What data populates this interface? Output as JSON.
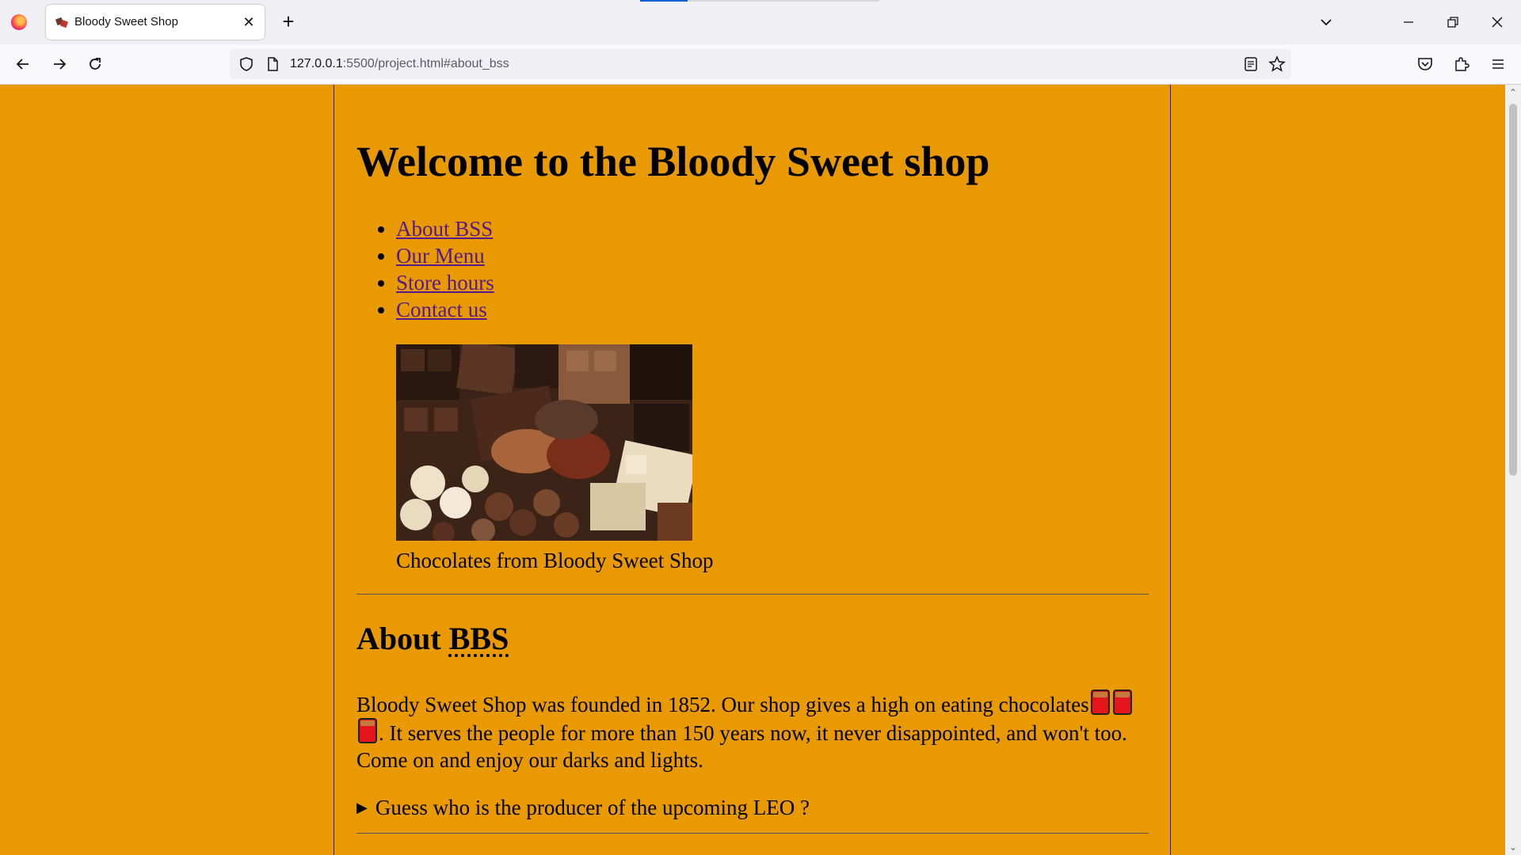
{
  "browser": {
    "tab_title": "Bloody Sweet Shop",
    "tab_close": "✕",
    "new_tab": "+",
    "url_host": "127.0.0.1",
    "url_rest": ":5500/project.html#about_bss",
    "loading_fraction": 0.2
  },
  "page": {
    "heading": "Welcome to the Bloody Sweet shop",
    "nav": [
      "About BSS",
      "Our Menu",
      "Store hours",
      "Contact us"
    ],
    "caption": "Chocolates from Bloody Sweet Shop",
    "about_title": "About ",
    "about_abbr": "BBS",
    "about_p1": "Bloody Sweet Shop was founded in 1852. Our shop gives a high on eating chocolates",
    "about_p2": ". It serves the people for more than 150 years now, it never disappointed, and won't too. Come on and enjoy our darks and lights.",
    "details_summary": "Guess who is the producer of the upcoming LEO ?",
    "details_marker": "▶",
    "emoji_name": "chocolate-bar-icon"
  },
  "colors": {
    "page_bg": "#e99a03",
    "link": "#551a8b"
  }
}
